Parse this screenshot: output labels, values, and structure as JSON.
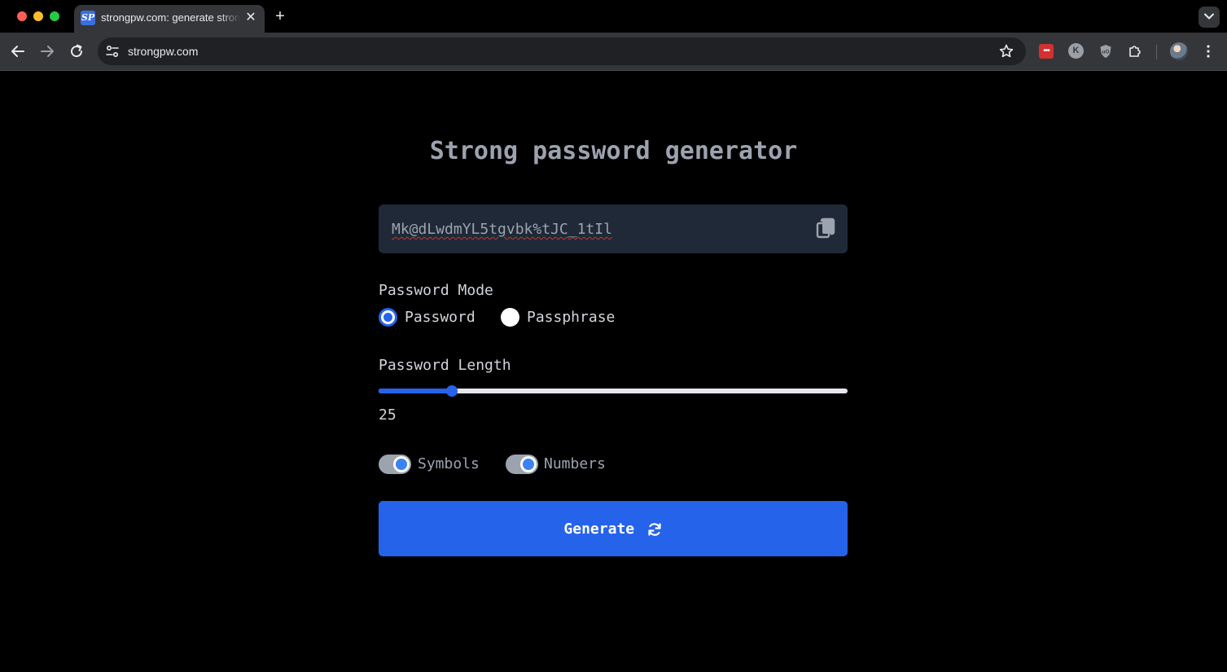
{
  "browser": {
    "tab_title": "strongpw.com: generate strong passwords",
    "favicon_text": "SP",
    "url": "strongpw.com",
    "extensions": {
      "red_ext_text": "•••",
      "k_ext_text": "K"
    }
  },
  "page": {
    "title": "Strong password generator",
    "password": "Mk@dLwdmYL5tgvbk%tJC_1tIl",
    "mode": {
      "label": "Password Mode",
      "options": [
        "Password",
        "Passphrase"
      ],
      "selected": "Password"
    },
    "length": {
      "label": "Password Length",
      "value": "25",
      "slider_fraction": 0.157
    },
    "toggles": {
      "symbols": {
        "label": "Symbols",
        "on": true
      },
      "numbers": {
        "label": "Numbers",
        "on": true
      }
    },
    "generate_label": "Generate"
  },
  "colors": {
    "accent": "#2563eb",
    "page_bg": "#000000",
    "input_bg": "#1f2937",
    "muted_text": "#9ca3af"
  }
}
